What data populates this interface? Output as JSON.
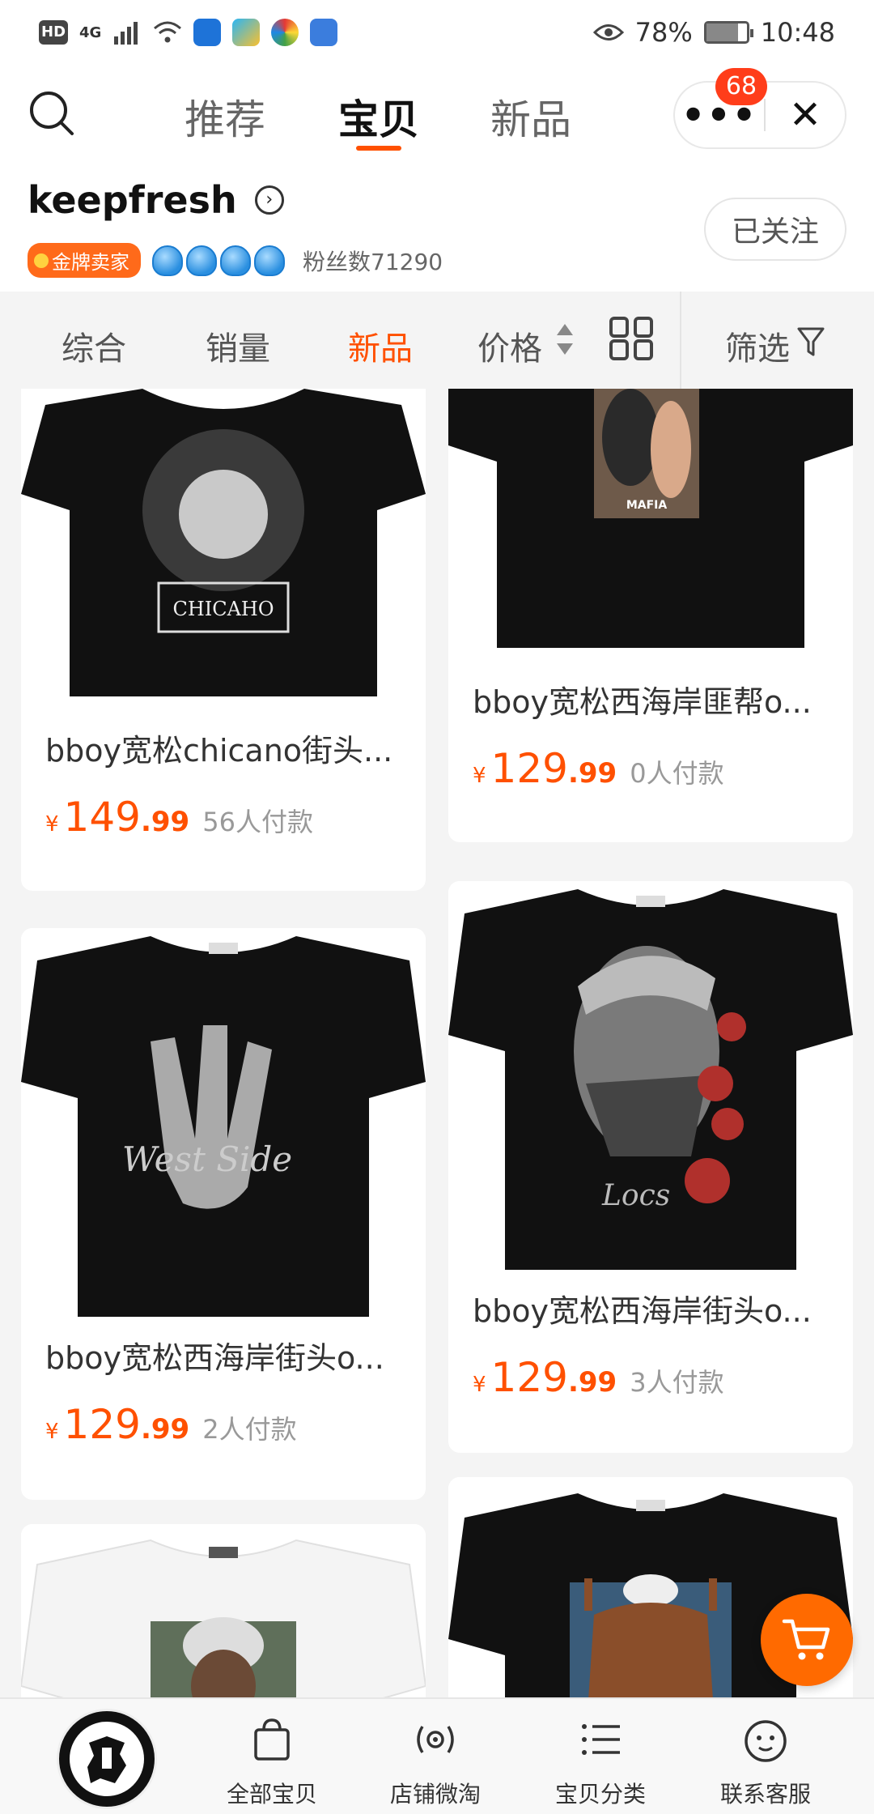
{
  "status_bar": {
    "left_badges": [
      "HD",
      "4G"
    ],
    "battery": "78%",
    "battery_level": 0.78,
    "time": "10:48"
  },
  "top_nav": {
    "tabs": [
      {
        "label": "推荐",
        "active": false
      },
      {
        "label": "宝贝",
        "active": true
      },
      {
        "label": "新品",
        "active": false
      }
    ],
    "more_icon": "more-dots-icon",
    "close_icon": "close-icon",
    "message_count": "68"
  },
  "shop": {
    "name": "keepfresh",
    "badge": "金牌卖家",
    "crown_count": 4,
    "fans": "粉丝数71290",
    "follow_label": "已关注"
  },
  "sort_bar": {
    "items": [
      {
        "label": "综合",
        "active": false
      },
      {
        "label": "销量",
        "active": false
      },
      {
        "label": "新品",
        "active": true
      },
      {
        "label": "价格",
        "active": false
      }
    ],
    "filter_label": "筛选"
  },
  "products": [
    {
      "title": "bboy宽松chicano街头...",
      "currency": "¥",
      "price_int": "149",
      "price_dec": ".99",
      "paid": "56人付款",
      "image_text": "CHICAHO",
      "shirt_color": "#111111"
    },
    {
      "title": "bboy宽松西海岸匪帮o...",
      "currency": "¥",
      "price_int": "129",
      "price_dec": ".99",
      "paid": "0人付款",
      "image_text": "MAFIA",
      "shirt_color": "#111111"
    },
    {
      "title": "bboy宽松西海岸街头o...",
      "currency": "¥",
      "price_int": "129",
      "price_dec": ".99",
      "paid": "2人付款",
      "image_text": "West Side",
      "shirt_color": "#111111"
    },
    {
      "title": "bboy宽松西海岸街头o...",
      "currency": "¥",
      "price_int": "129",
      "price_dec": ".99",
      "paid": "3人付款",
      "image_text": "Locs",
      "shirt_color": "#111111"
    },
    {
      "title": "",
      "image_text": "",
      "shirt_color": "#f4f4f4"
    },
    {
      "title": "",
      "image_text": "",
      "shirt_color": "#111111"
    }
  ],
  "bottom_nav": {
    "items": [
      {
        "label": "全部宝贝",
        "icon": "bag-icon"
      },
      {
        "label": "店铺微淘",
        "icon": "broadcast-icon"
      },
      {
        "label": "宝贝分类",
        "icon": "list-icon"
      },
      {
        "label": "联系客服",
        "icon": "chat-face-icon"
      }
    ]
  },
  "colors": {
    "accent": "#ff5000",
    "cart_fab": "#ff6a00",
    "badge_red": "#ff3d1a"
  }
}
